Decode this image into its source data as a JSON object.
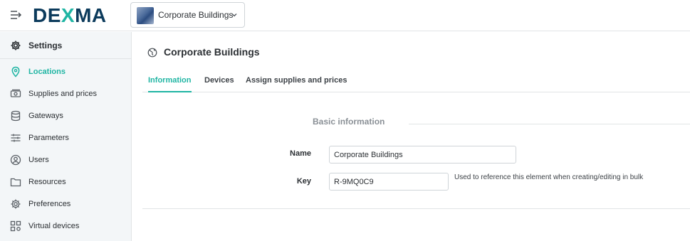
{
  "app": {
    "logo_prefix": "DE",
    "logo_x": "X",
    "logo_suffix": "MA"
  },
  "header": {
    "location_selector": {
      "value": "Corporate Buildings"
    }
  },
  "sidebar": {
    "header": {
      "label": "Settings",
      "icon": "gear-icon"
    },
    "items": [
      {
        "label": "Locations",
        "icon": "map-pin-icon",
        "active": true
      },
      {
        "label": "Supplies and prices",
        "icon": "money-icon"
      },
      {
        "label": "Gateways",
        "icon": "database-icon"
      },
      {
        "label": "Parameters",
        "icon": "sliders-icon"
      },
      {
        "label": "Users",
        "icon": "user-icon"
      },
      {
        "label": "Resources",
        "icon": "folder-icon"
      },
      {
        "label": "Preferences",
        "icon": "gear-icon"
      },
      {
        "label": "Virtual devices",
        "icon": "grid-gear-icon"
      }
    ]
  },
  "main": {
    "title": "Corporate Buildings",
    "tabs": [
      {
        "label": "Information",
        "active": true
      },
      {
        "label": "Devices"
      },
      {
        "label": "Assign supplies and prices"
      }
    ],
    "section_title": "Basic information",
    "fields": {
      "name": {
        "label": "Name",
        "value": "Corporate Buildings"
      },
      "key": {
        "label": "Key",
        "value": "R-9MQ0C9",
        "helper": "Used to reference this element when creating/editing in bulk"
      }
    }
  },
  "colors": {
    "accent": "#1fb5a3",
    "brand": "#0c3b5c"
  }
}
